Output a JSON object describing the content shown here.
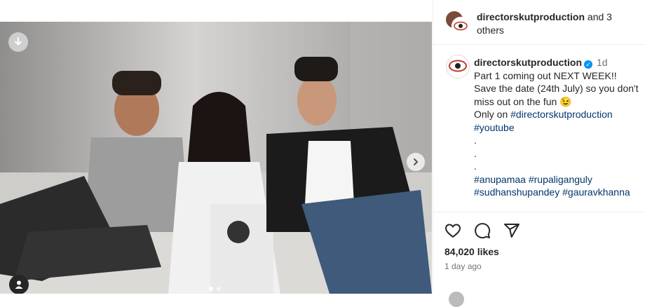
{
  "header": {
    "username": "directorskutproduction",
    "others_text": " and 3 others"
  },
  "caption": {
    "username": "directorskutproduction",
    "time": "1d",
    "line1": "Part 1 coming out NEXT WEEK!!",
    "line2": "Save the date (24th July) so you don't miss out on the fun 😉",
    "line3_prefix": "Only on ",
    "hashtag_main": "#directorskutproduction",
    "hashtag_youtube": "#youtube",
    "dot1": ".",
    "dot2": ".",
    "dot3": ".",
    "tags": [
      "#anupamaa",
      "#rupaliganguly",
      "#sudhanshupandey",
      "#gauravkhanna"
    ]
  },
  "stats": {
    "likes": "84,020 likes",
    "ago": "1 day ago"
  },
  "carousel": {
    "total": 2,
    "active_index": 0
  },
  "icons": {
    "like": "heart-icon",
    "comment": "comment-icon",
    "share": "share-icon",
    "download": "download-icon",
    "next": "chevron-right-icon",
    "tagged": "user-icon"
  }
}
